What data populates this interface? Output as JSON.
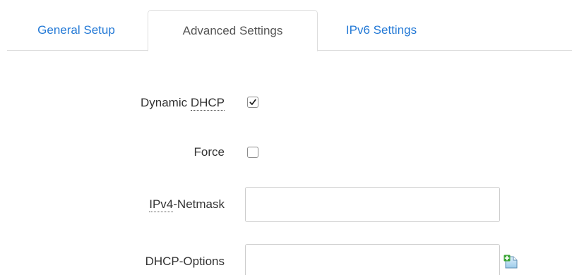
{
  "tabs": [
    {
      "label": "General Setup",
      "active": false
    },
    {
      "label": "Advanced Settings",
      "active": true
    },
    {
      "label": "IPv6 Settings",
      "active": false
    }
  ],
  "form": {
    "dynamic_dhcp": {
      "label_prefix": "Dynamic ",
      "label_abbr": "DHCP",
      "checked": true
    },
    "force": {
      "label": "Force",
      "checked": false
    },
    "ipv4_netmask": {
      "label_abbr": "IPv4",
      "label_suffix": "-Netmask",
      "value": ""
    },
    "dhcp_options": {
      "label": "DHCP-Options",
      "value": "",
      "add_icon": "add-entry-icon"
    }
  },
  "colors": {
    "link": "#2379d6",
    "active_tab_text": "#555555",
    "label": "#333333",
    "border": "#dddddd",
    "add_icon_green": "#3aa535"
  }
}
